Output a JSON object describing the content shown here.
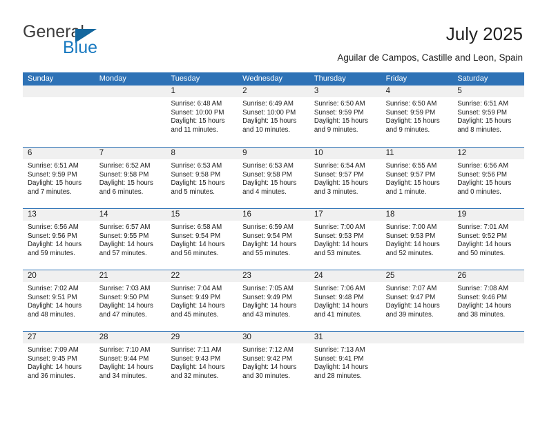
{
  "brand": {
    "name_part1": "General",
    "name_part2": "Blue",
    "triangle_color": "#14679e",
    "blue_color": "#1879c0"
  },
  "header": {
    "title": "July 2025",
    "location": "Aguilar de Campos, Castille and Leon, Spain"
  },
  "theme": {
    "header_blue": "#2e72b6",
    "number_band_gray": "#f0f0f0",
    "text_color": "#1a1a1a"
  },
  "weekday_headers": [
    "Sunday",
    "Monday",
    "Tuesday",
    "Wednesday",
    "Thursday",
    "Friday",
    "Saturday"
  ],
  "weeks": [
    [
      {
        "day": "",
        "sunrise": "",
        "sunset": "",
        "daylight_line1": "",
        "daylight_line2": ""
      },
      {
        "day": "",
        "sunrise": "",
        "sunset": "",
        "daylight_line1": "",
        "daylight_line2": ""
      },
      {
        "day": "1",
        "sunrise": "Sunrise: 6:48 AM",
        "sunset": "Sunset: 10:00 PM",
        "daylight_line1": "Daylight: 15 hours",
        "daylight_line2": "and 11 minutes."
      },
      {
        "day": "2",
        "sunrise": "Sunrise: 6:49 AM",
        "sunset": "Sunset: 10:00 PM",
        "daylight_line1": "Daylight: 15 hours",
        "daylight_line2": "and 10 minutes."
      },
      {
        "day": "3",
        "sunrise": "Sunrise: 6:50 AM",
        "sunset": "Sunset: 9:59 PM",
        "daylight_line1": "Daylight: 15 hours",
        "daylight_line2": "and 9 minutes."
      },
      {
        "day": "4",
        "sunrise": "Sunrise: 6:50 AM",
        "sunset": "Sunset: 9:59 PM",
        "daylight_line1": "Daylight: 15 hours",
        "daylight_line2": "and 9 minutes."
      },
      {
        "day": "5",
        "sunrise": "Sunrise: 6:51 AM",
        "sunset": "Sunset: 9:59 PM",
        "daylight_line1": "Daylight: 15 hours",
        "daylight_line2": "and 8 minutes."
      }
    ],
    [
      {
        "day": "6",
        "sunrise": "Sunrise: 6:51 AM",
        "sunset": "Sunset: 9:59 PM",
        "daylight_line1": "Daylight: 15 hours",
        "daylight_line2": "and 7 minutes."
      },
      {
        "day": "7",
        "sunrise": "Sunrise: 6:52 AM",
        "sunset": "Sunset: 9:58 PM",
        "daylight_line1": "Daylight: 15 hours",
        "daylight_line2": "and 6 minutes."
      },
      {
        "day": "8",
        "sunrise": "Sunrise: 6:53 AM",
        "sunset": "Sunset: 9:58 PM",
        "daylight_line1": "Daylight: 15 hours",
        "daylight_line2": "and 5 minutes."
      },
      {
        "day": "9",
        "sunrise": "Sunrise: 6:53 AM",
        "sunset": "Sunset: 9:58 PM",
        "daylight_line1": "Daylight: 15 hours",
        "daylight_line2": "and 4 minutes."
      },
      {
        "day": "10",
        "sunrise": "Sunrise: 6:54 AM",
        "sunset": "Sunset: 9:57 PM",
        "daylight_line1": "Daylight: 15 hours",
        "daylight_line2": "and 3 minutes."
      },
      {
        "day": "11",
        "sunrise": "Sunrise: 6:55 AM",
        "sunset": "Sunset: 9:57 PM",
        "daylight_line1": "Daylight: 15 hours",
        "daylight_line2": "and 1 minute."
      },
      {
        "day": "12",
        "sunrise": "Sunrise: 6:56 AM",
        "sunset": "Sunset: 9:56 PM",
        "daylight_line1": "Daylight: 15 hours",
        "daylight_line2": "and 0 minutes."
      }
    ],
    [
      {
        "day": "13",
        "sunrise": "Sunrise: 6:56 AM",
        "sunset": "Sunset: 9:56 PM",
        "daylight_line1": "Daylight: 14 hours",
        "daylight_line2": "and 59 minutes."
      },
      {
        "day": "14",
        "sunrise": "Sunrise: 6:57 AM",
        "sunset": "Sunset: 9:55 PM",
        "daylight_line1": "Daylight: 14 hours",
        "daylight_line2": "and 57 minutes."
      },
      {
        "day": "15",
        "sunrise": "Sunrise: 6:58 AM",
        "sunset": "Sunset: 9:54 PM",
        "daylight_line1": "Daylight: 14 hours",
        "daylight_line2": "and 56 minutes."
      },
      {
        "day": "16",
        "sunrise": "Sunrise: 6:59 AM",
        "sunset": "Sunset: 9:54 PM",
        "daylight_line1": "Daylight: 14 hours",
        "daylight_line2": "and 55 minutes."
      },
      {
        "day": "17",
        "sunrise": "Sunrise: 7:00 AM",
        "sunset": "Sunset: 9:53 PM",
        "daylight_line1": "Daylight: 14 hours",
        "daylight_line2": "and 53 minutes."
      },
      {
        "day": "18",
        "sunrise": "Sunrise: 7:00 AM",
        "sunset": "Sunset: 9:53 PM",
        "daylight_line1": "Daylight: 14 hours",
        "daylight_line2": "and 52 minutes."
      },
      {
        "day": "19",
        "sunrise": "Sunrise: 7:01 AM",
        "sunset": "Sunset: 9:52 PM",
        "daylight_line1": "Daylight: 14 hours",
        "daylight_line2": "and 50 minutes."
      }
    ],
    [
      {
        "day": "20",
        "sunrise": "Sunrise: 7:02 AM",
        "sunset": "Sunset: 9:51 PM",
        "daylight_line1": "Daylight: 14 hours",
        "daylight_line2": "and 48 minutes."
      },
      {
        "day": "21",
        "sunrise": "Sunrise: 7:03 AM",
        "sunset": "Sunset: 9:50 PM",
        "daylight_line1": "Daylight: 14 hours",
        "daylight_line2": "and 47 minutes."
      },
      {
        "day": "22",
        "sunrise": "Sunrise: 7:04 AM",
        "sunset": "Sunset: 9:49 PM",
        "daylight_line1": "Daylight: 14 hours",
        "daylight_line2": "and 45 minutes."
      },
      {
        "day": "23",
        "sunrise": "Sunrise: 7:05 AM",
        "sunset": "Sunset: 9:49 PM",
        "daylight_line1": "Daylight: 14 hours",
        "daylight_line2": "and 43 minutes."
      },
      {
        "day": "24",
        "sunrise": "Sunrise: 7:06 AM",
        "sunset": "Sunset: 9:48 PM",
        "daylight_line1": "Daylight: 14 hours",
        "daylight_line2": "and 41 minutes."
      },
      {
        "day": "25",
        "sunrise": "Sunrise: 7:07 AM",
        "sunset": "Sunset: 9:47 PM",
        "daylight_line1": "Daylight: 14 hours",
        "daylight_line2": "and 39 minutes."
      },
      {
        "day": "26",
        "sunrise": "Sunrise: 7:08 AM",
        "sunset": "Sunset: 9:46 PM",
        "daylight_line1": "Daylight: 14 hours",
        "daylight_line2": "and 38 minutes."
      }
    ],
    [
      {
        "day": "27",
        "sunrise": "Sunrise: 7:09 AM",
        "sunset": "Sunset: 9:45 PM",
        "daylight_line1": "Daylight: 14 hours",
        "daylight_line2": "and 36 minutes."
      },
      {
        "day": "28",
        "sunrise": "Sunrise: 7:10 AM",
        "sunset": "Sunset: 9:44 PM",
        "daylight_line1": "Daylight: 14 hours",
        "daylight_line2": "and 34 minutes."
      },
      {
        "day": "29",
        "sunrise": "Sunrise: 7:11 AM",
        "sunset": "Sunset: 9:43 PM",
        "daylight_line1": "Daylight: 14 hours",
        "daylight_line2": "and 32 minutes."
      },
      {
        "day": "30",
        "sunrise": "Sunrise: 7:12 AM",
        "sunset": "Sunset: 9:42 PM",
        "daylight_line1": "Daylight: 14 hours",
        "daylight_line2": "and 30 minutes."
      },
      {
        "day": "31",
        "sunrise": "Sunrise: 7:13 AM",
        "sunset": "Sunset: 9:41 PM",
        "daylight_line1": "Daylight: 14 hours",
        "daylight_line2": "and 28 minutes."
      },
      {
        "day": "",
        "sunrise": "",
        "sunset": "",
        "daylight_line1": "",
        "daylight_line2": ""
      },
      {
        "day": "",
        "sunrise": "",
        "sunset": "",
        "daylight_line1": "",
        "daylight_line2": ""
      }
    ]
  ]
}
